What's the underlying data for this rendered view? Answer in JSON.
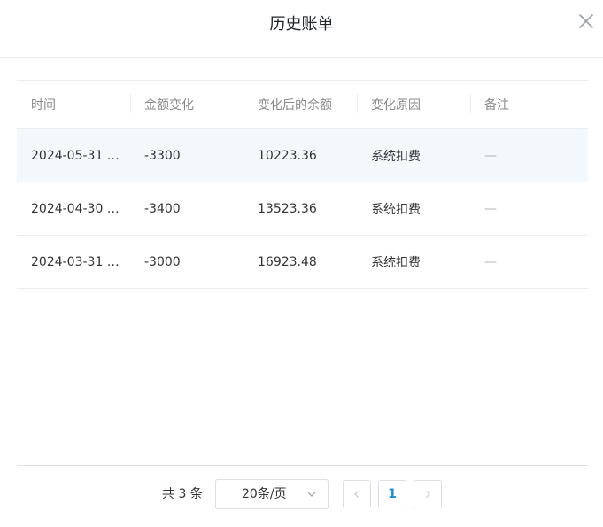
{
  "dialog": {
    "title": "历史账单"
  },
  "table": {
    "columns": [
      "时间",
      "金额变化",
      "变化后的余额",
      "变化原因",
      "备注"
    ],
    "rows": [
      {
        "time": "2024-05-31 …",
        "amount": "-3300",
        "balance": "10223.36",
        "reason": "系统扣费",
        "note": "—"
      },
      {
        "time": "2024-04-30 …",
        "amount": "-3400",
        "balance": "13523.36",
        "reason": "系统扣费",
        "note": "—"
      },
      {
        "time": "2024-03-31 …",
        "amount": "-3000",
        "balance": "16923.48",
        "reason": "系统扣费",
        "note": "—"
      }
    ]
  },
  "pagination": {
    "total": "共 3 条",
    "page_size": "20条/页",
    "current_page": "1"
  },
  "icons": {
    "close": "close-icon",
    "dropdown": "chevron-down-icon",
    "prev": "chevron-left-icon",
    "next": "chevron-right-icon"
  },
  "colors": {
    "accent": "#1a8fe0",
    "row_highlight": "#f3f8fd",
    "border": "#ebedf0"
  }
}
